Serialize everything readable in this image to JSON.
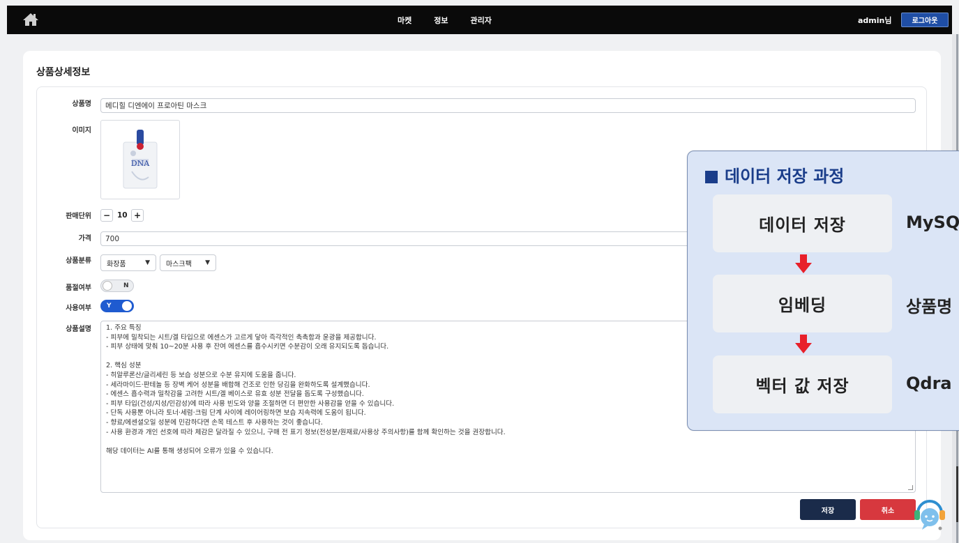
{
  "nav": {
    "links": [
      "마켓",
      "정보",
      "관리자"
    ],
    "user": "admin님",
    "logout": "로그아웃"
  },
  "page": {
    "title": "상품상세정보"
  },
  "form": {
    "name_label": "상품명",
    "name_value": "메디힐 디엔에이 프로아틴 마스크",
    "image_label": "이미지",
    "image_text": "DNA",
    "unit_label": "판매단위",
    "unit_minus": "−",
    "unit_value": "10",
    "unit_plus": "+",
    "price_label": "가격",
    "price_value": "700",
    "category_label": "상품분류",
    "category1": "화장품",
    "category2": "마스크팩",
    "soldout_label": "품절여부",
    "soldout_value": "N",
    "use_label": "사용여부",
    "use_value": "Y",
    "desc_label": "상품설명",
    "desc_lines": [
      "1. 주요 특징",
      "- 피부에 밀착되는 시트/겔 타입으로 에센스가 고르게 닿아 즉각적인 촉촉함과 윤광을 제공합니다.",
      "- 피부 상태에 맞춰 10~20분 사용 후 잔여 에센스를 흡수시키면 수분감이 오래 유지되도록 돕습니다.",
      "",
      "2. 핵심 성분",
      "- 히알루론산/글리세린 등 보습 성분으로 수분 유지에 도움을 줍니다.",
      "- 세라마이드·판테놀 등 장벽 케어 성분을 배합해 건조로 인한 당김을 완화하도록 설계했습니다.",
      "- 에센스 흡수력과 밀착감을 고려한 시트/겔 베이스로 유효 성분 전달을 돕도록 구성했습니다.",
      "- 피부 타입(건성/지성/민감성)에 따라 사용 빈도와 양을 조절하면 더 편안한 사용감을 얻을 수 있습니다.",
      "- 단독 사용뿐 아니라 토너·세럼·크림 단계 사이에 레이어링하면 보습 지속력에 도움이 됩니다.",
      "- 향료/에센셜오일 성분에 민감하다면 손목 테스트 후 사용하는 것이 좋습니다.",
      "- 사용 환경과 개인 선호에 따라 체감은 달라질 수 있으니, 구매 전 표기 정보(전성분/원재료/사용상 주의사항)를 함께 확인하는 것을 권장합니다.",
      "",
      "해당 데이터는 AI를 통해 생성되어 오류가 있을 수 있습니다."
    ],
    "save": "저장",
    "cancel": "취소"
  },
  "overlay": {
    "title": "데이터 저장 과정",
    "steps": [
      {
        "label": "데이터 저장",
        "side": "MySQ"
      },
      {
        "label": "임베딩",
        "side": "상품명"
      },
      {
        "label": "벡터 값 저장",
        "side": "Qdra"
      }
    ],
    "arrow_color": "#e8202a"
  },
  "colors": {
    "primary": "#1a2b4a",
    "danger": "#d7383e",
    "accent": "#1f5bd0",
    "overlay_title": "#1a3d8a"
  }
}
